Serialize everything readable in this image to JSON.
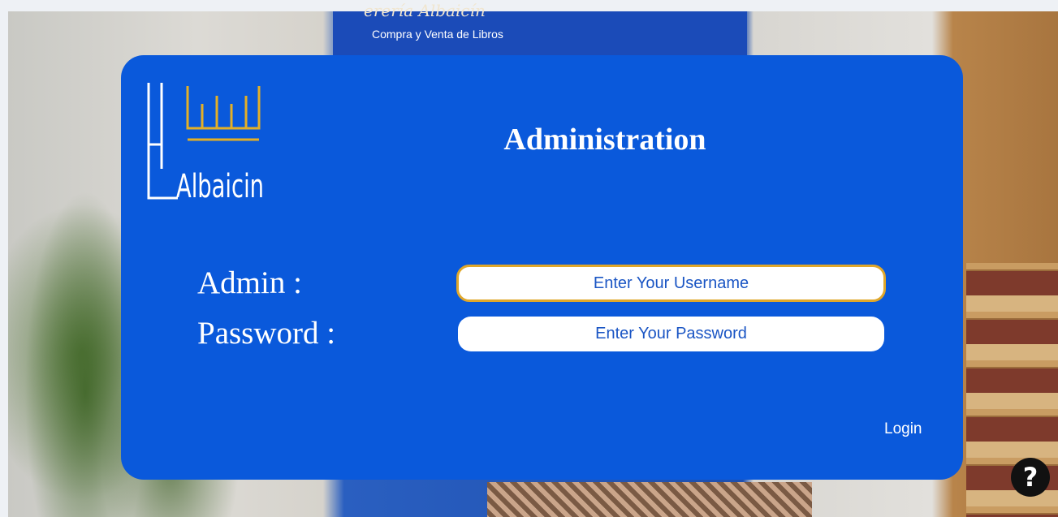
{
  "background": {
    "sign_text": "erería Albaicín",
    "sign_sub": "Compra y Venta de Libros"
  },
  "card": {
    "title": "Administration",
    "logo_text": "Albaicin",
    "logo_color": "#e4b026",
    "accent": "#0a59db"
  },
  "form": {
    "admin_label": "Admin :",
    "password_label": "Password :",
    "username_placeholder": "Enter Your Username",
    "password_placeholder": "Enter Your Password",
    "login_label": "Login"
  },
  "help": {
    "icon": "question-icon",
    "glyph": "?"
  }
}
